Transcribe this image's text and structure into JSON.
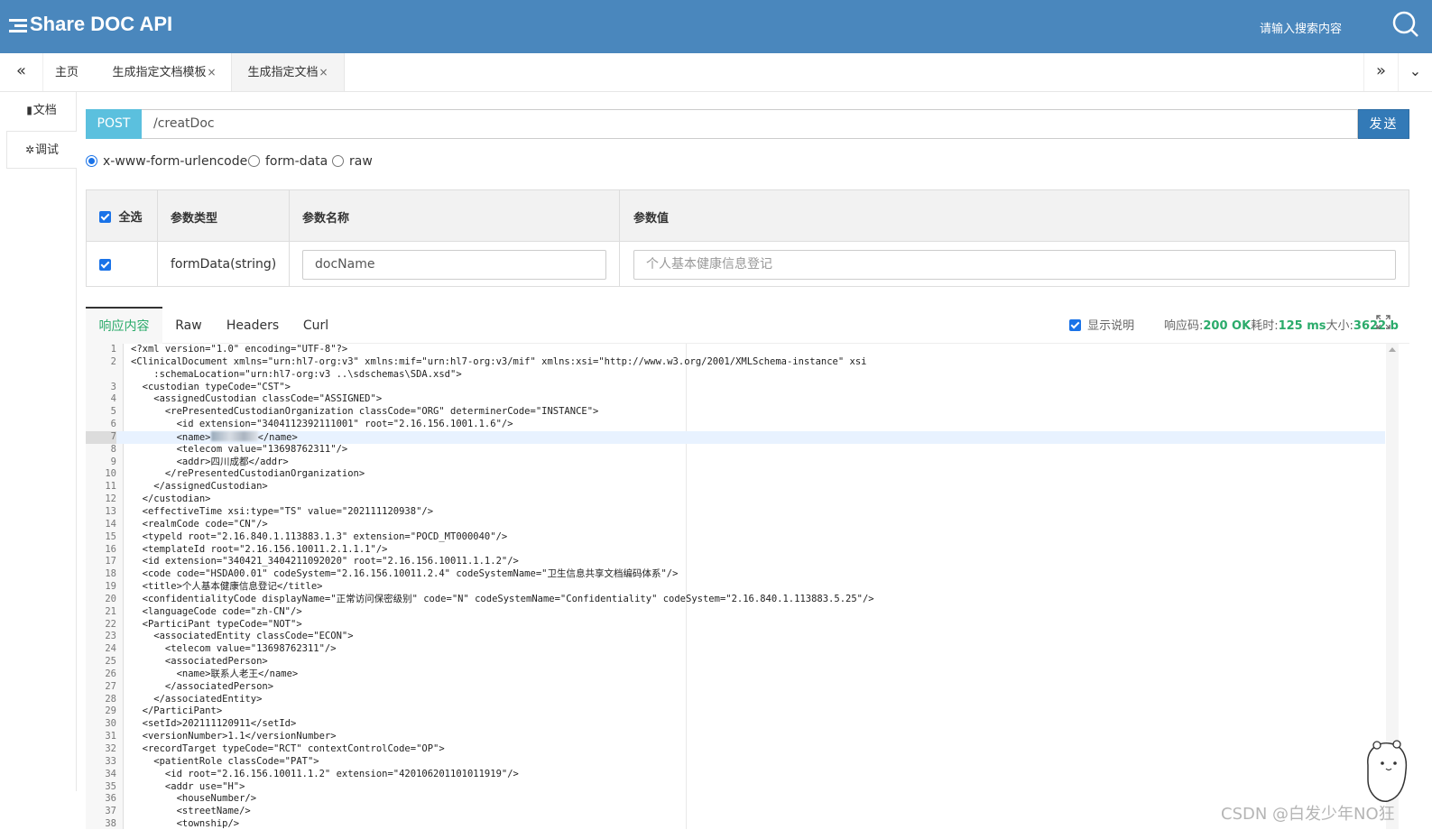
{
  "header": {
    "title": "Share DOC API",
    "search_placeholder": "请输入搜索内容"
  },
  "tabs": [
    {
      "label": "主页",
      "closable": false
    },
    {
      "label": "生成指定文档模板",
      "closable": true
    },
    {
      "label": "生成指定文档",
      "closable": true,
      "active": true
    }
  ],
  "tab_nav": {
    "left": "«",
    "right": "»",
    "more": "⌄"
  },
  "tab_close": "×",
  "sidebar": [
    {
      "label": "文档",
      "icon": "document-icon",
      "glyph": "▮"
    },
    {
      "label": "调试",
      "icon": "bug-icon",
      "glyph": "✲",
      "active": true
    }
  ],
  "request": {
    "method": "POST",
    "url": "/creatDoc",
    "send_label": "发送"
  },
  "body_types": [
    {
      "label": "x-www-form-urlencoded",
      "checked": true
    },
    {
      "label": "form-data",
      "checked": false
    },
    {
      "label": "raw",
      "checked": false
    }
  ],
  "params_table": {
    "headers": {
      "select_all": "全选",
      "type": "参数类型",
      "name": "参数名称",
      "value": "参数值"
    },
    "rows": [
      {
        "checked": true,
        "type": "formData(string)",
        "name": "docName",
        "value_placeholder": "个人基本健康信息登记"
      }
    ]
  },
  "response_tabs": [
    "响应内容",
    "Raw",
    "Headers",
    "Curl"
  ],
  "response_meta": {
    "show_desc_label": "显示说明",
    "code_label": "响应码:",
    "code_value": "200 OK",
    "time_label": "耗时:",
    "time_value": "125 ms",
    "size_label": "大小:",
    "size_value": "3622 b"
  },
  "editor": {
    "highlight_line": 7,
    "lines": [
      {
        "n": "1",
        "t": "<?xml version=\"1.0\" encoding=\"UTF-8\"?>"
      },
      {
        "n": "2",
        "t": "<ClinicalDocument xmlns=\"urn:hl7-org:v3\" xmlns:mif=\"urn:hl7-org:v3/mif\" xmlns:xsi=\"http://www.w3.org/2001/XMLSchema-instance\" xsi"
      },
      {
        "n": "",
        "t": "    :schemaLocation=\"urn:hl7-org:v3 ..\\sdschemas\\SDA.xsd\">"
      },
      {
        "n": "3",
        "t": "  <custodian typeCode=\"CST\">"
      },
      {
        "n": "4",
        "t": "    <assignedCustodian classCode=\"ASSIGNED\">"
      },
      {
        "n": "5",
        "t": "      <rePresentedCustodianOrganization classCode=\"ORG\" determinerCode=\"INSTANCE\">"
      },
      {
        "n": "6",
        "t": "        <id extension=\"3404112392111001\" root=\"2.16.156.1001.1.6\"/>"
      },
      {
        "n": "7",
        "pre": "        <name>",
        "blurred": true,
        "post": "</name>"
      },
      {
        "n": "8",
        "t": "        <telecom value=\"13698762311\"/>"
      },
      {
        "n": "9",
        "t": "        <addr>四川成都</addr>"
      },
      {
        "n": "10",
        "t": "      </rePresentedCustodianOrganization>"
      },
      {
        "n": "11",
        "t": "    </assignedCustodian>"
      },
      {
        "n": "12",
        "t": "  </custodian>"
      },
      {
        "n": "13",
        "t": "  <effectiveTime xsi:type=\"TS\" value=\"202111120938\"/>"
      },
      {
        "n": "14",
        "t": "  <realmCode code=\"CN\"/>"
      },
      {
        "n": "15",
        "t": "  <typeld root=\"2.16.840.1.113883.1.3\" extension=\"POCD_MT000040\"/>"
      },
      {
        "n": "16",
        "t": "  <templateId root=\"2.16.156.10011.2.1.1.1\"/>"
      },
      {
        "n": "17",
        "t": "  <id extension=\"340421_3404211092020\" root=\"2.16.156.10011.1.1.2\"/>"
      },
      {
        "n": "18",
        "t": "  <code code=\"HSDA00.01\" codeSystem=\"2.16.156.10011.2.4\" codeSystemName=\"卫生信息共享文档编码体系\"/>"
      },
      {
        "n": "19",
        "t": "  <title>个人基本健康信息登记</title>"
      },
      {
        "n": "20",
        "t": "  <confidentialityCode displayName=\"正常访问保密级别\" code=\"N\" codeSystemName=\"Confidentiality\" codeSystem=\"2.16.840.1.113883.5.25\"/>"
      },
      {
        "n": "21",
        "t": "  <languageCode code=\"zh-CN\"/>"
      },
      {
        "n": "22",
        "t": "  <ParticiPant typeCode=\"NOT\">"
      },
      {
        "n": "23",
        "t": "    <associatedEntity classCode=\"ECON\">"
      },
      {
        "n": "24",
        "t": "      <telecom value=\"13698762311\"/>"
      },
      {
        "n": "25",
        "t": "      <associatedPerson>"
      },
      {
        "n": "26",
        "t": "        <name>联系人老王</name>"
      },
      {
        "n": "27",
        "t": "      </associatedPerson>"
      },
      {
        "n": "28",
        "t": "    </associatedEntity>"
      },
      {
        "n": "29",
        "t": "  </ParticiPant>"
      },
      {
        "n": "30",
        "t": "  <setId>202111120911</setId>"
      },
      {
        "n": "31",
        "t": "  <versionNumber>1.1</versionNumber>"
      },
      {
        "n": "32",
        "t": "  <recordTarget typeCode=\"RCT\" contextControlCode=\"OP\">"
      },
      {
        "n": "33",
        "t": "    <patientRole classCode=\"PAT\">"
      },
      {
        "n": "34",
        "t": "      <id root=\"2.16.156.10011.1.2\" extension=\"420106201101011919\"/>"
      },
      {
        "n": "35",
        "t": "      <addr use=\"H\">"
      },
      {
        "n": "36",
        "t": "        <houseNumber/>"
      },
      {
        "n": "37",
        "t": "        <streetName/>"
      },
      {
        "n": "38",
        "t": "        <township/>"
      }
    ]
  },
  "watermark": "CSDN @白发少年NO狂",
  "colors": {
    "header_bg": "#4a87bd",
    "method_bg": "#5bc0de",
    "send_bg": "#337ab7",
    "status_green": "#2bab6b",
    "checkbox_blue": "#1a73e8"
  }
}
